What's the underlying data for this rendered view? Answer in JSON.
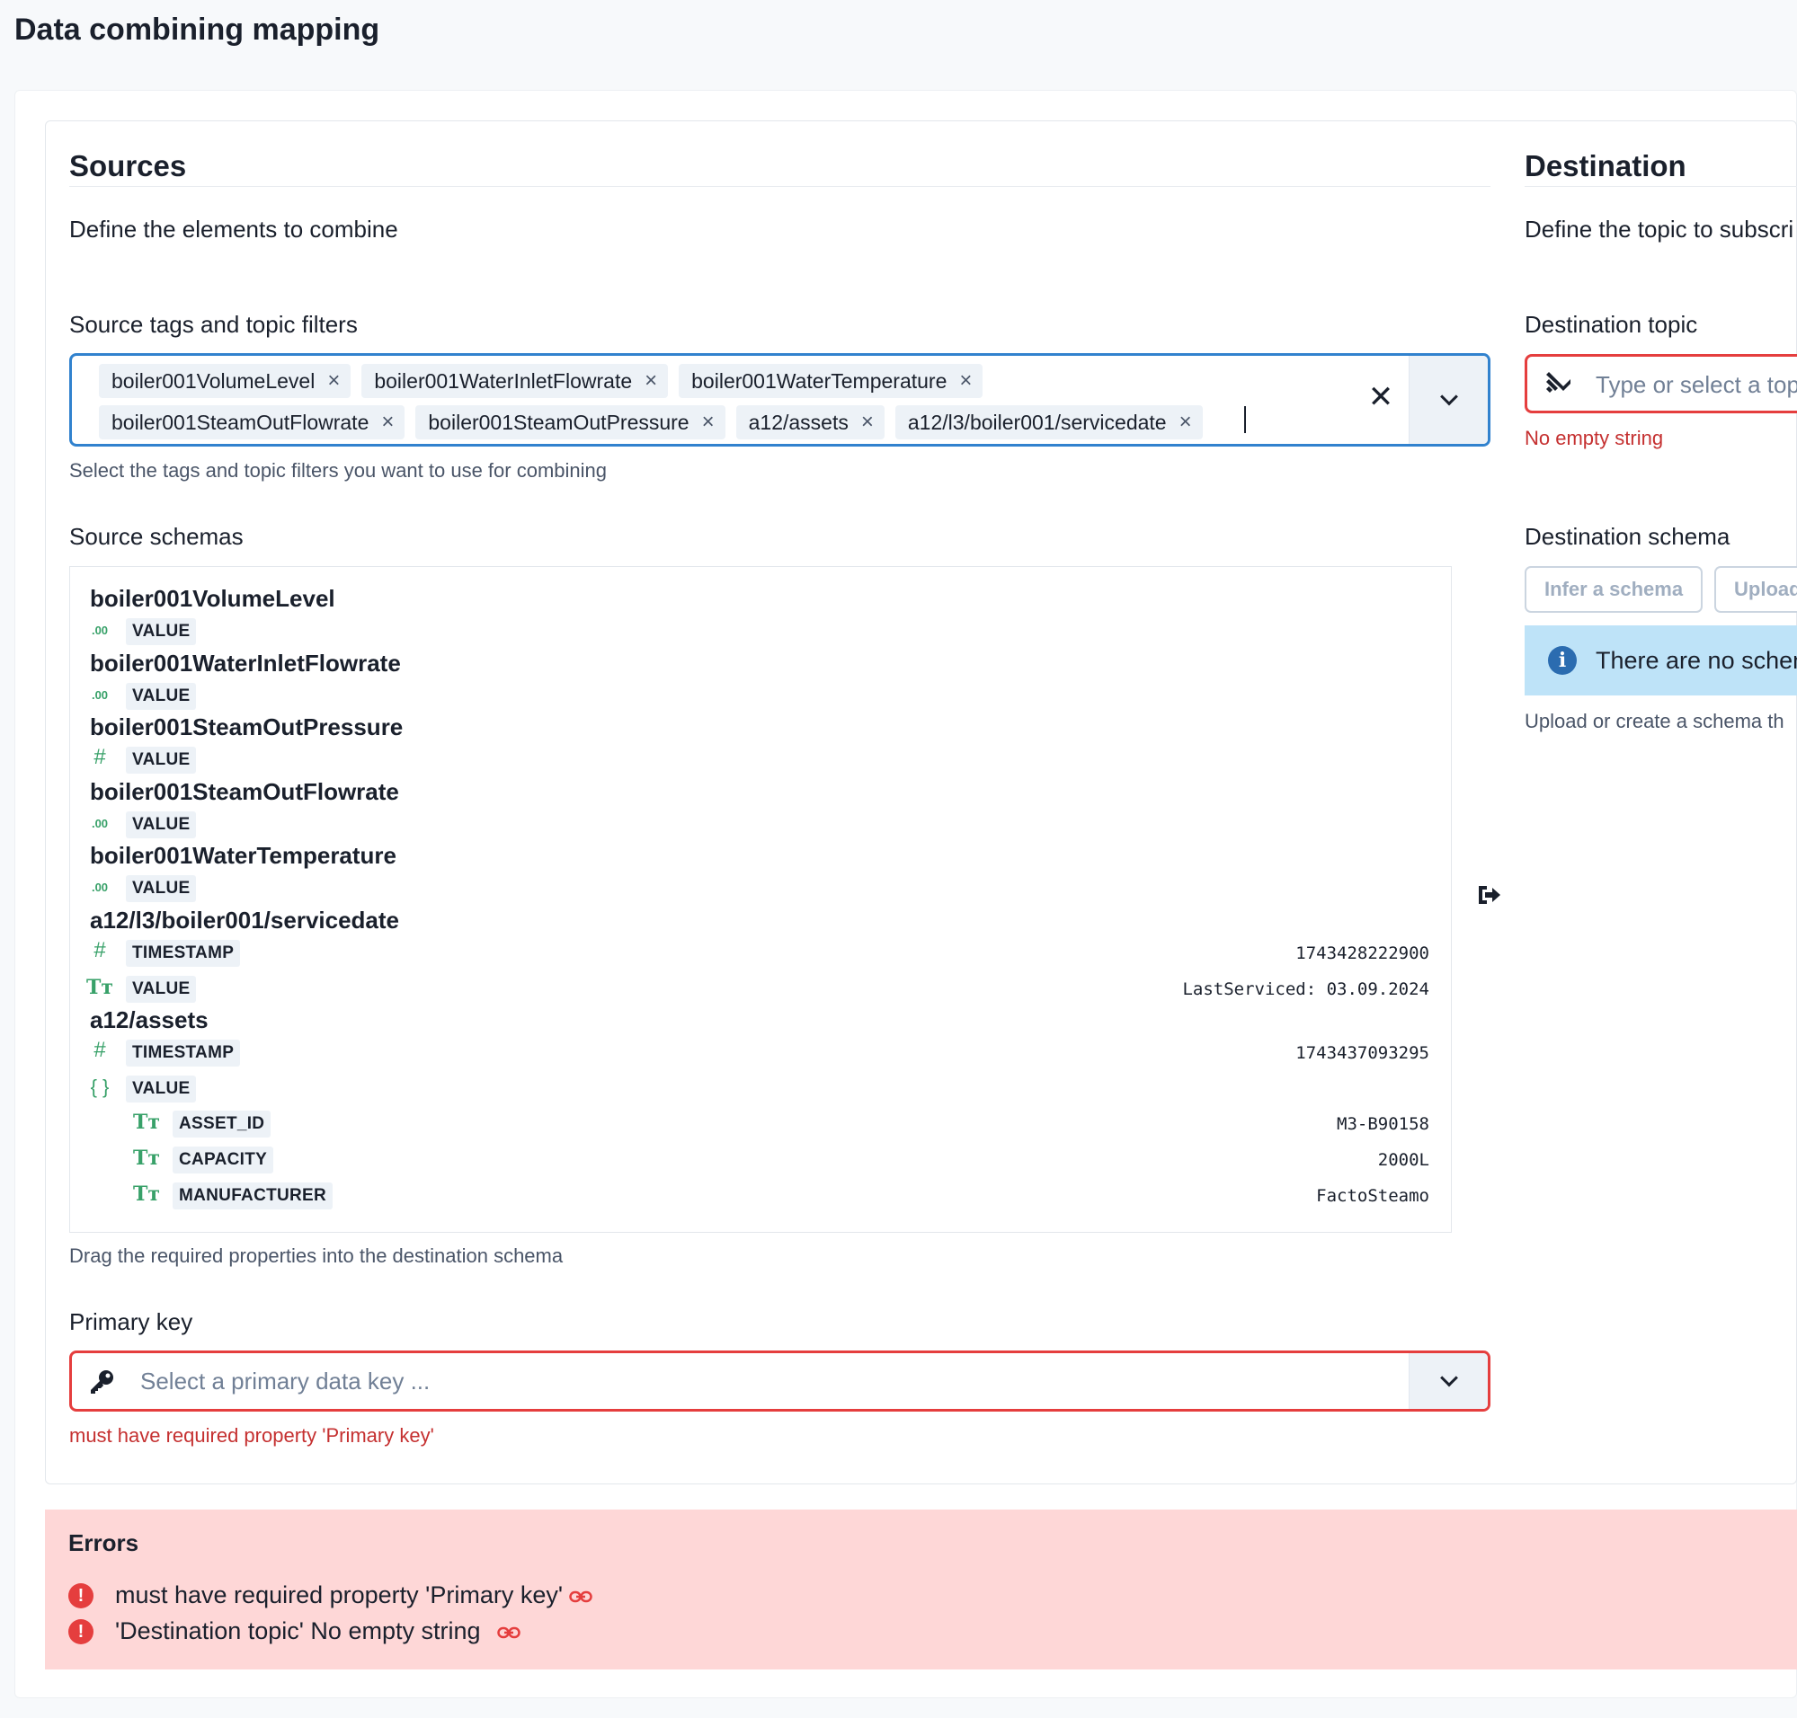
{
  "page": {
    "title": "Data combining mapping"
  },
  "sources": {
    "title": "Sources",
    "description": "Define the elements to combine",
    "tags_label": "Source tags and topic filters",
    "tags": [
      "boiler001VolumeLevel",
      "boiler001WaterInletFlowrate",
      "boiler001WaterTemperature",
      "boiler001SteamOutFlowrate",
      "boiler001SteamOutPressure",
      "a12/assets",
      "a12/l3/boiler001/servicedate"
    ],
    "tags_helper": "Select the tags and topic filters you want to use for combining",
    "schemas_label": "Source schemas",
    "schemas": [
      {
        "name": "boiler001VolumeLevel",
        "props": [
          {
            "type": "decimal",
            "name": "VALUE",
            "value": ""
          }
        ]
      },
      {
        "name": "boiler001WaterInletFlowrate",
        "props": [
          {
            "type": "decimal",
            "name": "VALUE",
            "value": ""
          }
        ]
      },
      {
        "name": "boiler001SteamOutPressure",
        "props": [
          {
            "type": "integer",
            "name": "VALUE",
            "value": ""
          }
        ]
      },
      {
        "name": "boiler001SteamOutFlowrate",
        "props": [
          {
            "type": "decimal",
            "name": "VALUE",
            "value": ""
          }
        ]
      },
      {
        "name": "boiler001WaterTemperature",
        "props": [
          {
            "type": "decimal",
            "name": "VALUE",
            "value": ""
          }
        ]
      },
      {
        "name": "a12/l3/boiler001/servicedate",
        "props": [
          {
            "type": "integer",
            "name": "TIMESTAMP",
            "value": "1743428222900"
          },
          {
            "type": "string",
            "name": "VALUE",
            "value": "LastServiced: 03.09.2024"
          }
        ]
      },
      {
        "name": "a12/assets",
        "props": [
          {
            "type": "integer",
            "name": "TIMESTAMP",
            "value": "1743437093295"
          },
          {
            "type": "object",
            "name": "VALUE",
            "value": ""
          },
          {
            "type": "string",
            "name": "ASSET_ID",
            "value": "M3-B90158",
            "nested": true
          },
          {
            "type": "string",
            "name": "CAPACITY",
            "value": "2000L",
            "nested": true
          },
          {
            "type": "string",
            "name": "MANUFACTURER",
            "value": "FactoSteamo",
            "nested": true
          }
        ]
      }
    ],
    "schemas_helper": "Drag the required properties into the destination schema",
    "primary_key_label": "Primary key",
    "primary_key_placeholder": "Select a primary data key ...",
    "primary_key_error": "must have required property 'Primary key'"
  },
  "destination": {
    "title": "Destination",
    "description": "Define the topic to subscri",
    "topic_label": "Destination topic",
    "topic_placeholder": "Type or select a top",
    "topic_error": "No empty string",
    "schema_label": "Destination schema",
    "infer_button": "Infer a schema",
    "upload_button": "Upload",
    "no_schema_alert": "There are no schem",
    "schema_helper": "Upload or create a schema th"
  },
  "errors": {
    "title": "Errors",
    "items": [
      "must have required property 'Primary key'",
      "'Destination topic' No empty string"
    ]
  },
  "colors": {
    "accent": "#3182ce",
    "error": "#e53e3e",
    "error_bg": "#fed7d7",
    "info_bg": "#bee3f8",
    "type_icon": "#38a169"
  },
  "icons": {
    "type_decimal": ".00",
    "type_integer": "#",
    "type_string": "Tт",
    "type_object": "{ }",
    "remove_chip": "×",
    "clear_all": "✕",
    "error": "!",
    "info": "i"
  }
}
